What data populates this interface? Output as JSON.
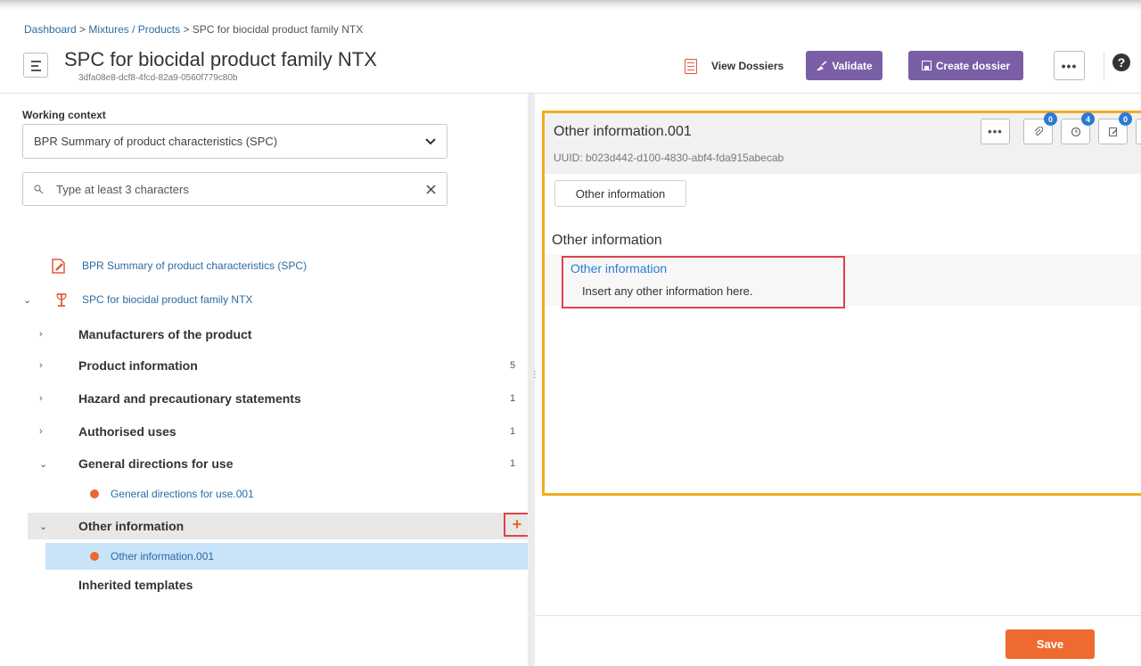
{
  "breadcrumb": {
    "dashboard": "Dashboard",
    "sep1": " > ",
    "mixtures": "Mixtures / Products",
    "sep2": " > ",
    "current": "SPC for biocidal product family NTX"
  },
  "header": {
    "title": "SPC for biocidal product family NTX",
    "uuid": "3dfa08e8-dcf8-4fcd-82a9-0560f779c80b",
    "view_dossiers": "View Dossiers",
    "validate": "Validate",
    "create_dossier": "Create dossier",
    "more": "•••",
    "help": "?"
  },
  "left": {
    "working_context_label": "Working context",
    "working_context_value": "BPR Summary of product characteristics (SPC)",
    "search_placeholder": "Type at least 3 characters",
    "tree": {
      "root_template": "BPR Summary of product characteristics (SPC)",
      "root_doc": "SPC for biocidal product family NTX",
      "sections": [
        {
          "label": "Manufacturers of the product",
          "count": ""
        },
        {
          "label": "Product information",
          "count": "5"
        },
        {
          "label": "Hazard and precautionary statements",
          "count": "1"
        },
        {
          "label": "Authorised uses",
          "count": "1"
        },
        {
          "label": "General directions for use",
          "count": "1"
        },
        {
          "label": "Other information",
          "count": ""
        },
        {
          "label": "Inherited templates",
          "count": ""
        }
      ],
      "general_directions_child": "General directions for use.001",
      "other_information_child": "Other information.001",
      "add": "+"
    }
  },
  "right": {
    "title": "Other information.001",
    "uuid": "UUID: b023d442-d100-4830-abf4-fda915abecab",
    "more": "•••",
    "badges": {
      "attachments": "0",
      "history": "4",
      "annotations": "0"
    },
    "tab": "Other information",
    "section_title": "Other information",
    "field_label": "Other information",
    "field_value": "Insert any other information here.",
    "save": "Save"
  },
  "colors": {
    "accent_purple": "#7a5fa6",
    "save_orange": "#ef6a2e",
    "highlight_yellow": "#f0ad22",
    "annotation_red": "#e0414a",
    "link_blue": "#2b6ca3",
    "dot_orange": "#e8692e"
  }
}
